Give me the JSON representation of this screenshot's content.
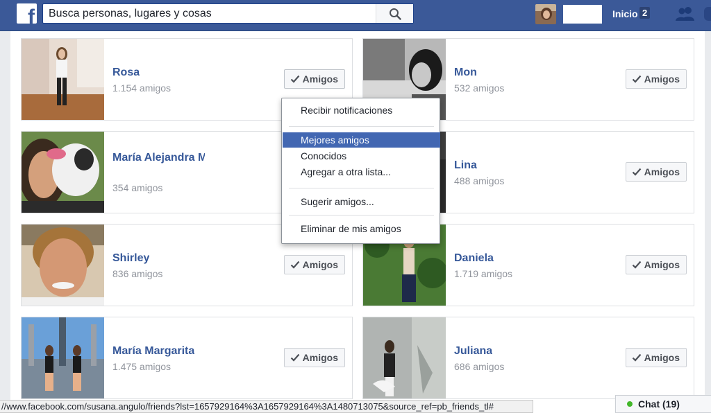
{
  "header": {
    "logo": "f",
    "search_placeholder": "Busca personas, lugares y cosas",
    "home_label": "Inicio",
    "home_count": "2"
  },
  "friend_button_label": "Amigos",
  "friends": [
    {
      "name": "Rosa",
      "count": "1.154 amigos"
    },
    {
      "name": "Mon",
      "count": "532 amigos"
    },
    {
      "name": "María Alejandra M",
      "count": "354 amigos"
    },
    {
      "name": "Lina",
      "count": "488 amigos"
    },
    {
      "name": "Shirley",
      "count": "836 amigos"
    },
    {
      "name": "Daniela",
      "count": "1.719 amigos"
    },
    {
      "name": "María Margarita",
      "count": "1.475 amigos"
    },
    {
      "name": "Juliana",
      "count": "686 amigos"
    }
  ],
  "dropdown": {
    "items": [
      "Recibir notificaciones",
      "Mejores amigos",
      "Conocidos",
      "Agregar a otra lista...",
      "Sugerir amigos...",
      "Eliminar de mis amigos"
    ],
    "highlight_color": "#4267b2"
  },
  "status_url": "//www.facebook.com/susana.angulo/friends?lst=1657929164%3A1657929164%3A1480713075&source_ref=pb_friends_tl#",
  "chat": {
    "label": "Chat (19)"
  },
  "colors": {
    "brand": "#3b5998",
    "link": "#365899",
    "online": "#42b72a"
  }
}
